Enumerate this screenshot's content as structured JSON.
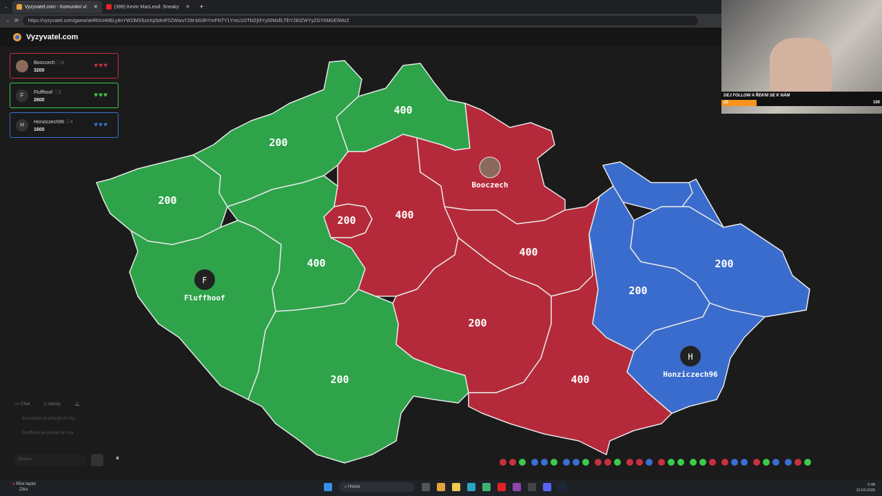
{
  "browser": {
    "tabs": [
      {
        "label": "Vyzyvatel.com - Komunitní ví"
      },
      {
        "label": "(399) Kevin MacLeod: Sneaky"
      }
    ],
    "new_tab": "+",
    "url": "https://vyzyvatel.com/game/aHR0cHM6Ly9nYW1lMS5zeXp5dmF0ZWwuY29t-bG9hYmFNTY1YmU1OTktZjhlYy00MzllLTlhY2EtZWYyZGY0MGE5MzZ"
  },
  "site": {
    "name": "Vyzyvatel.com"
  },
  "players": [
    {
      "name": "Booczech",
      "level": "4",
      "score": "3200",
      "initial": "",
      "color": "#c9303f",
      "hearts": "♥♥♥"
    },
    {
      "name": "Fluffhoof",
      "level": "2",
      "score": "2600",
      "initial": "F",
      "color": "#3ccb4a",
      "hearts": "♥♥♥"
    },
    {
      "name": "Honziczech96",
      "level": "4",
      "score": "1600",
      "initial": "H",
      "color": "#3a6ed6",
      "hearts": "♥♥♥"
    }
  ],
  "map": {
    "regions": [
      {
        "value": "400",
        "owner": "green"
      },
      {
        "value": "200",
        "owner": "green"
      },
      {
        "value": "200",
        "owner": "green"
      },
      {
        "value": "400",
        "owner": "green"
      },
      {
        "value": "200",
        "owner": "green"
      },
      {
        "value": "400",
        "owner": "red"
      },
      {
        "value": "200",
        "owner": "red"
      },
      {
        "value": "400",
        "owner": "red"
      },
      {
        "value": "200",
        "owner": "red"
      },
      {
        "value": "400",
        "owner": "red"
      },
      {
        "value": "200",
        "owner": "blue"
      },
      {
        "value": "200",
        "owner": "blue"
      }
    ],
    "bases": [
      {
        "player": "Booczech",
        "initial": ""
      },
      {
        "player": "Fluffhoof",
        "initial": "F"
      },
      {
        "player": "Honziczech96",
        "initial": "H"
      }
    ]
  },
  "chat": {
    "tab_chat": "Chat",
    "tab_questions": "otázky",
    "messages": [
      "booczech se připojil do hry",
      "Fluffhoof se připojil do hry"
    ],
    "input_placeholder": "Zpráva..."
  },
  "stream": {
    "banner": "DEJ FOLLOW A ŘEKNI SE K NÁM",
    "goal_current": "22",
    "goal_target": "100",
    "goal_fraction": 0.22
  },
  "taskbar": {
    "weather": "Růst teplot",
    "weather_sub": "Zítra",
    "search": "Hledat",
    "time": "0:48",
    "date": "12.04.2026"
  }
}
